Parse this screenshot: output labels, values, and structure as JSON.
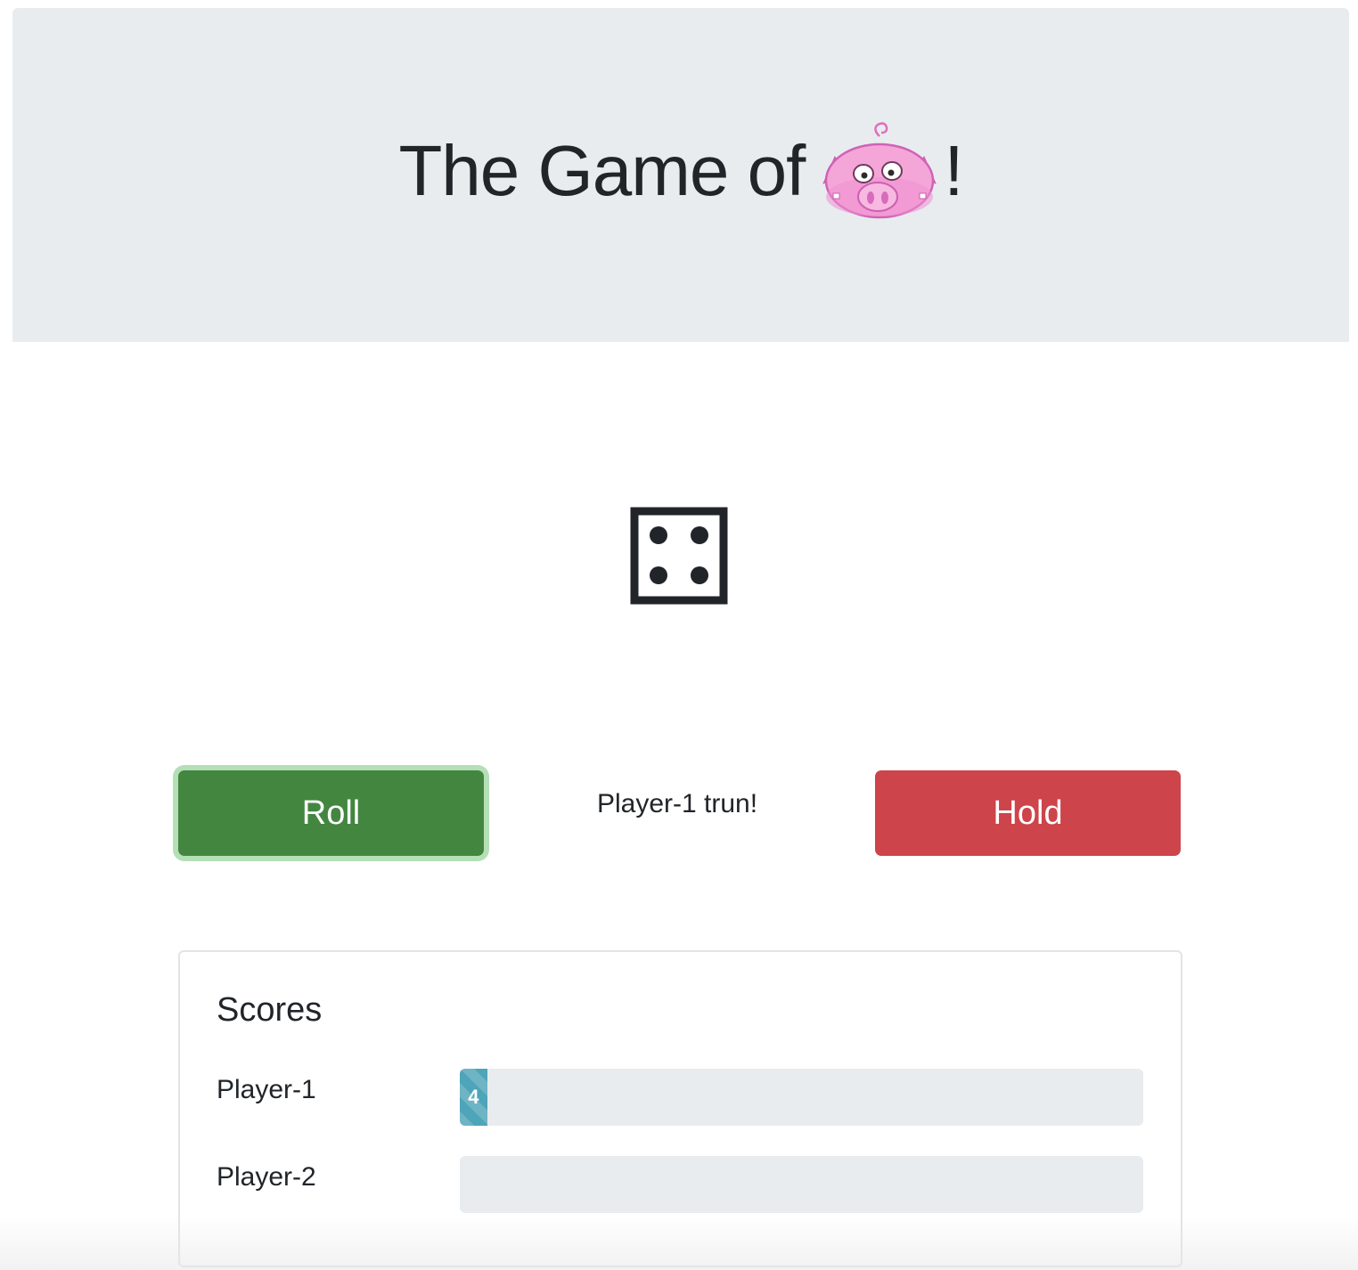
{
  "header": {
    "title_text": "The Game of",
    "title_suffix": "!",
    "logo_icon": "pig-face-icon"
  },
  "die": {
    "value": 4,
    "icon": "die-four-icon"
  },
  "controls": {
    "roll_label": "Roll",
    "hold_label": "Hold",
    "turn_message": "Player-1 trun!",
    "roll_color": "#438640",
    "hold_color": "#cd444a"
  },
  "scores": {
    "title": "Scores",
    "max_score": 100,
    "players": [
      {
        "label": "Player-1",
        "score": 4,
        "score_label": "4"
      },
      {
        "label": "Player-2",
        "score": 0,
        "score_label": ""
      }
    ],
    "bar_color": "#4ea4b8"
  }
}
